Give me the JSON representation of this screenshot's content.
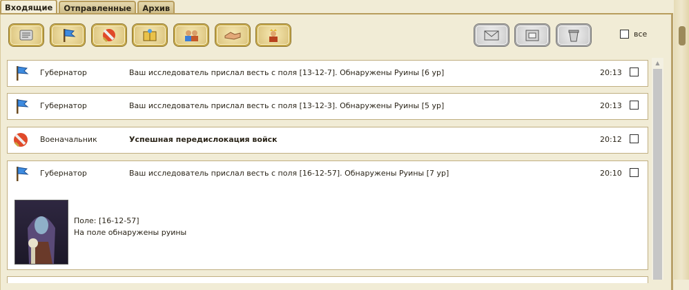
{
  "tabs": [
    {
      "label": "Входящие",
      "active": true
    },
    {
      "label": "Отправленные",
      "active": false
    },
    {
      "label": "Архив",
      "active": false
    }
  ],
  "toolbar": {
    "filters": [
      {
        "name": "scroll-icon"
      },
      {
        "name": "governor-flag-icon"
      },
      {
        "name": "war-sword-icon"
      },
      {
        "name": "book-icon"
      },
      {
        "name": "people-icon"
      },
      {
        "name": "handshake-icon"
      },
      {
        "name": "king-icon"
      }
    ],
    "actions": [
      {
        "name": "envelope-icon"
      },
      {
        "name": "archive-box-icon"
      },
      {
        "name": "trash-icon"
      }
    ],
    "select_all_label": "все"
  },
  "messages": [
    {
      "sender": "Губернатор",
      "subject": "Ваш исследователь прислал весть с поля [13-12-7]. Обнаружены Руины [6 ур]",
      "time": "20:13",
      "icon": "governor-flag-icon",
      "bold": false
    },
    {
      "sender": "Губернатор",
      "subject": "Ваш исследователь прислал весть с поля [13-12-3]. Обнаружены Руины [5 ур]",
      "time": "20:13",
      "icon": "governor-flag-icon",
      "bold": false
    },
    {
      "sender": "Военачальник",
      "subject": "Успешная передислокация войск",
      "time": "20:12",
      "icon": "war-sword-icon",
      "bold": true
    },
    {
      "sender": "Губернатор",
      "subject": "Ваш исследователь прислал весть с поля [16-12-57]. Обнаружены Руины [7 ур]",
      "time": "20:10",
      "icon": "governor-flag-icon",
      "bold": false,
      "expanded": {
        "line1": "Поле: [16-12-57]",
        "line2": "На поле обнаружены руины"
      }
    }
  ]
}
